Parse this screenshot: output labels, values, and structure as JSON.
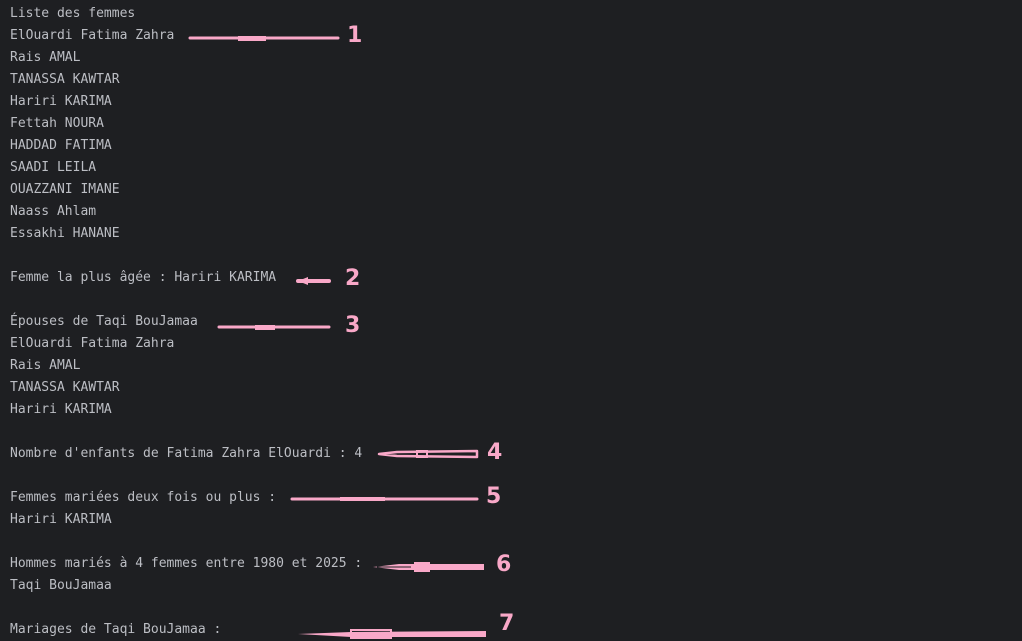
{
  "output": {
    "lines": [
      "Liste des femmes",
      "ElOuardi Fatima Zahra",
      "Rais AMAL",
      "TANASSA KAWTAR",
      "Hariri KARIMA",
      "Fettah NOURA",
      "HADDAD FATIMA",
      "SAADI LEILA",
      "OUAZZANI IMANE",
      "Naass Ahlam",
      "Essakhi HANANE",
      "",
      "Femme la plus âgée : Hariri KARIMA",
      "",
      "Épouses de Taqi BouJamaa",
      "ElOuardi Fatima Zahra",
      "Rais AMAL",
      "TANASSA KAWTAR",
      "Hariri KARIMA",
      "",
      "Nombre d'enfants de Fatima Zahra ElOuardi : 4",
      "",
      "Femmes mariées deux fois ou plus :",
      "Hariri KARIMA",
      "",
      "Hommes mariés à 4 femmes entre 1980 et 2025 :",
      "Taqi BouJamaa",
      "",
      "Mariages de Taqi BouJamaa :"
    ]
  },
  "annotations": {
    "color": "#f9a8c8",
    "labels": [
      "1",
      "2",
      "3",
      "4",
      "5",
      "6",
      "7"
    ]
  }
}
